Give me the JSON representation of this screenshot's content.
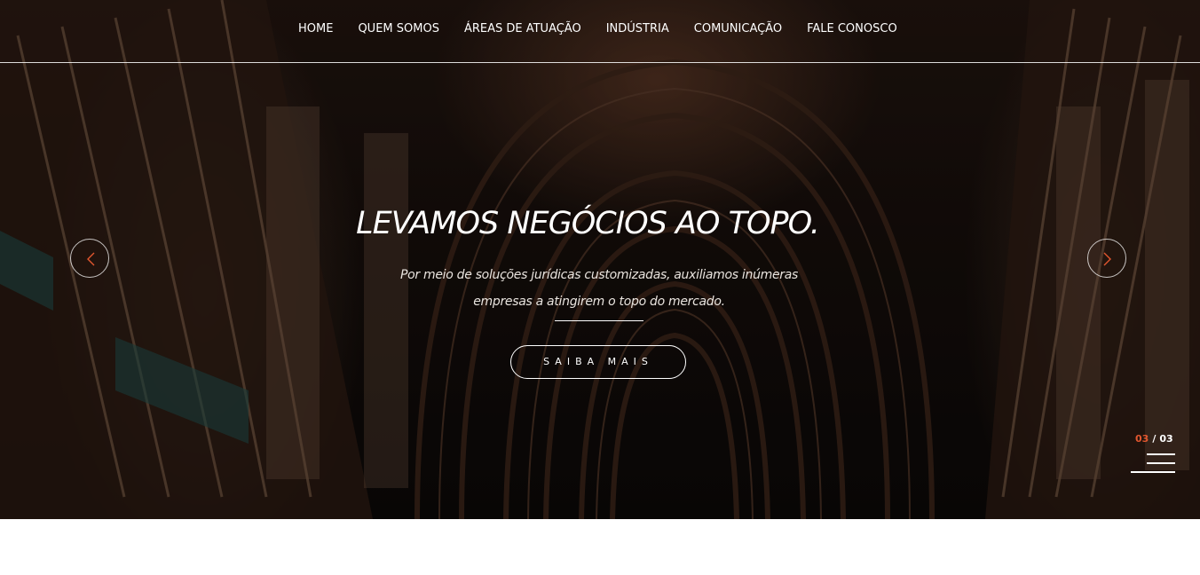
{
  "nav": {
    "items": [
      {
        "label": "HOME"
      },
      {
        "label": "QUEM SOMOS"
      },
      {
        "label": "ÁREAS DE ATUAÇÃO"
      },
      {
        "label": "INDÚSTRIA"
      },
      {
        "label": "COMUNICAÇÃO"
      },
      {
        "label": "FALE CONOSCO"
      }
    ]
  },
  "hero": {
    "headline": "LEVAMOS NEGÓCIOS AO TOPO.",
    "subtext_line1": "Por meio de soluções jurídicas customizadas, auxiliamos inúmeras",
    "subtext_line2": "empresas a atingirem o topo do mercado.",
    "cta_label": "SAIBA MAIS",
    "background": "dark library bookshelves and arched ceiling"
  },
  "slider": {
    "current": "03",
    "separator": "/",
    "total": "03",
    "prev_icon": "chevron-left-icon",
    "next_icon": "chevron-right-icon",
    "menu_icon": "hamburger-icon"
  },
  "colors": {
    "accent": "#e2572f",
    "text": "#ffffff",
    "background_below": "#ffffff"
  }
}
